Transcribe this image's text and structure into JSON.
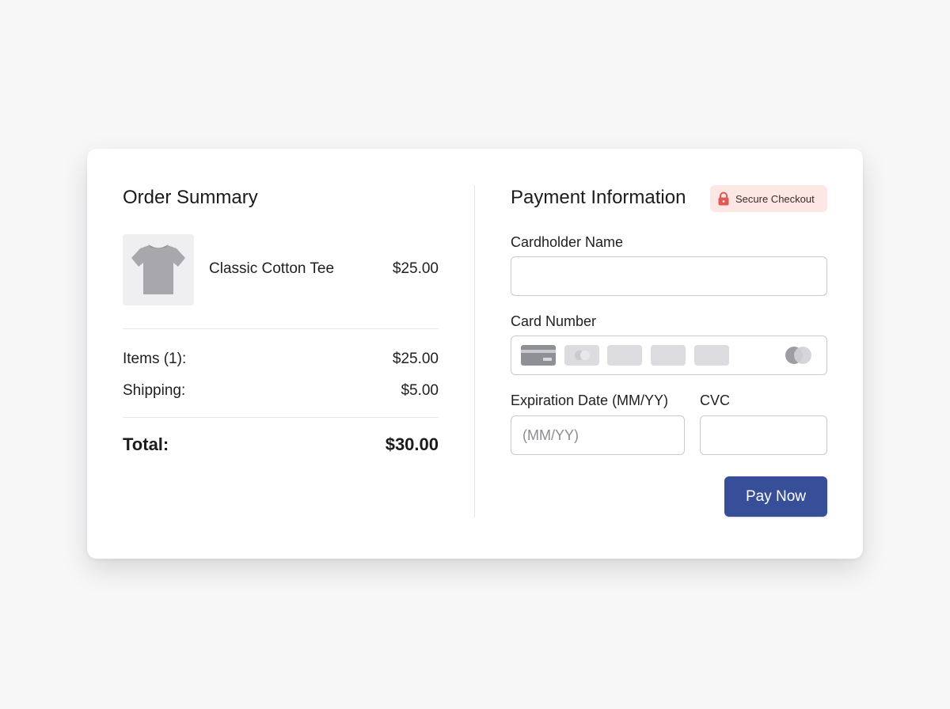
{
  "order_summary": {
    "title": "Order Summary",
    "product": {
      "name": "Classic Cotton Tee",
      "price": "$25.00",
      "image_icon": "tshirt-icon"
    },
    "items_label": "Items (1):",
    "items_value": "$25.00",
    "shipping_label": "Shipping:",
    "shipping_value": "$5.00",
    "total_label": "Total:",
    "total_value": "$30.00"
  },
  "payment": {
    "title": "Payment Information",
    "secure_badge": {
      "label": "Secure Checkout",
      "icon": "lock-icon",
      "background": "#fde7e5",
      "icon_color": "#e05a55"
    },
    "cardholder_label": "Cardholder Name",
    "cardholder_value": "",
    "card_number_label": "Card Number",
    "card_brand_icons": [
      "generic-card-icon",
      "visa-icon",
      "amex-icon",
      "discover-icon",
      "jcb-icon",
      "mastercard-icon"
    ],
    "expiration_label": "Expiration Date (MM/YY)",
    "expiration_placeholder": "(MM/YY)",
    "expiration_value": "",
    "cvc_label": "CVC",
    "cvc_value": "",
    "pay_button_label": "Pay Now",
    "pay_button_color": "#364f98"
  }
}
